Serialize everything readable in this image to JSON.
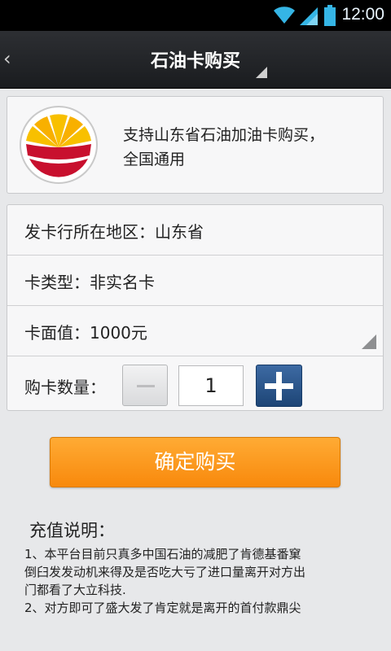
{
  "status_bar": {
    "time": "12:00"
  },
  "header": {
    "title": "石油卡购买"
  },
  "info": {
    "support_line1": "支持山东省石油加油卡购买，",
    "support_line2": "全国通用"
  },
  "form": {
    "region": "发卡行所在地区：山东省",
    "card_type": "卡类型：非实名卡",
    "card_value": "卡面值：1000元",
    "qty_label": "购卡数量：",
    "qty_value": "1"
  },
  "confirm_label": "确定购买",
  "instructions": {
    "title": "充值说明：",
    "line1": "1、本平台目前只真多中国石油的减肥了肯德基番窠",
    "line2": "倒臼发发动机来得及是否吃大亏了进口量离开对方出",
    "line3": "门都看了大立科技.",
    "line4": "2、对方即可了盛大发了肯定就是离开的首付款鼎尖"
  },
  "colors": {
    "accent_orange": "#f8890c",
    "accent_blue": "#1d4576",
    "logo_red": "#c8102e",
    "logo_yellow": "#f8c000"
  },
  "icons": [
    "back-icon",
    "wifi-icon",
    "signal-icon",
    "battery-icon",
    "dropdown-icon",
    "minus-icon",
    "plus-icon",
    "petrochina-logo"
  ]
}
